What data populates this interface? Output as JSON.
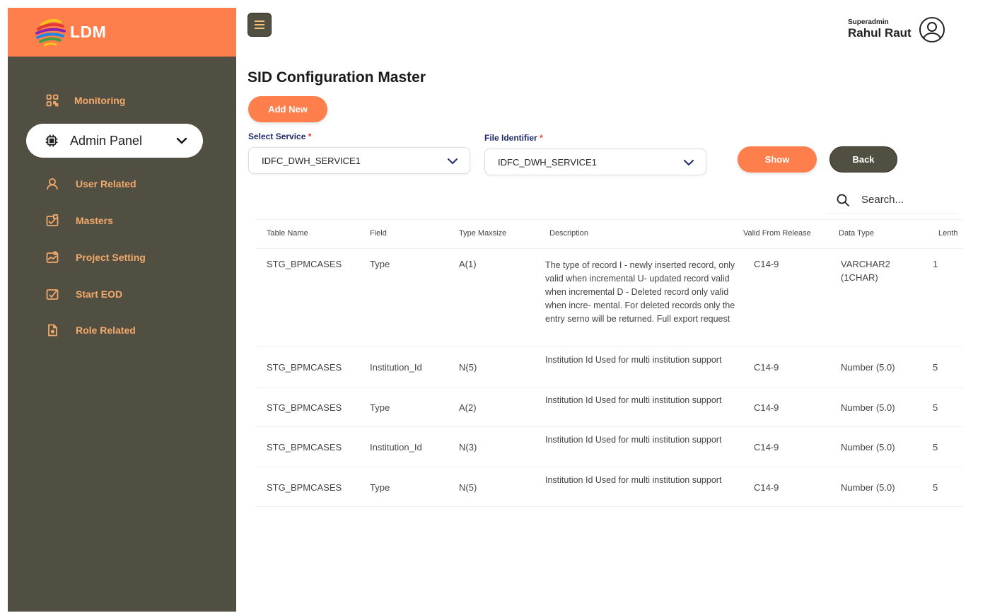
{
  "app": {
    "name": "LDM"
  },
  "sidebar": {
    "items": [
      {
        "label": "Monitoring",
        "icon": "grid-icon"
      },
      {
        "label": "Admin Panel",
        "icon": "chip-icon",
        "active": true
      },
      {
        "label": "User Related",
        "icon": "user-icon"
      },
      {
        "label": "Masters",
        "icon": "masters-icon"
      },
      {
        "label": "Project Setting",
        "icon": "project-setting-icon"
      },
      {
        "label": "Start EOD",
        "icon": "start-eod-icon"
      },
      {
        "label": "Role Related",
        "icon": "document-icon"
      }
    ]
  },
  "header": {
    "role": "Superadmin",
    "user_name": "Rahul Raut"
  },
  "page": {
    "title": "SID Configuration Master",
    "add_new_label": "Add New",
    "show_label": "Show",
    "back_label": "Back"
  },
  "filters": {
    "service_label": "Select Service",
    "service_value": "IDFC_DWH_SERVICE1",
    "file_label": "File Identifier",
    "file_value": "IDFC_DWH_SERVICE1",
    "required_mark": "*"
  },
  "search": {
    "placeholder": "Search..."
  },
  "table": {
    "headers": [
      "Table Name",
      "Field",
      "Type Maxsize",
      "Description",
      "Valid From Release",
      "Data Type",
      "Lenth"
    ],
    "rows": [
      {
        "table_name": "STG_BPMCASES",
        "field": "Type",
        "type_maxsize": "A(1)",
        "description": "The type of record I - newly inserted record, only valid when incremental U- updated record valid when incremental D - Deleted record only valid when incre- mental. For deleted records only the entry serno will be returned. Full export request",
        "valid_from": "C14-9",
        "data_type": "VARCHAR2 (1CHAR)",
        "length": "1"
      },
      {
        "table_name": "STG_BPMCASES",
        "field": "Institution_Id",
        "type_maxsize": "N(5)",
        "description": "Institution Id Used for multi institution support",
        "valid_from": "C14-9",
        "data_type": "Number (5.0)",
        "length": "5"
      },
      {
        "table_name": "STG_BPMCASES",
        "field": "Type",
        "type_maxsize": "A(2)",
        "description": "Institution Id Used for multi institution support",
        "valid_from": "C14-9",
        "data_type": "Number (5.0)",
        "length": "5"
      },
      {
        "table_name": "STG_BPMCASES",
        "field": "Institution_Id",
        "type_maxsize": "N(3)",
        "description": "Institution Id Used for multi institution support",
        "valid_from": "C14-9",
        "data_type": "Number (5.0)",
        "length": "5"
      },
      {
        "table_name": "STG_BPMCASES",
        "field": "Type",
        "type_maxsize": "N(5)",
        "description": "Institution Id Used for multi institution support",
        "valid_from": "C14-9",
        "data_type": "Number (5.0)",
        "length": "5"
      }
    ]
  },
  "colors": {
    "accent": "#fe7e4c",
    "sidebar_bg": "#514f41",
    "nav_text": "#f2a96c",
    "label_blue": "#1f2a6b"
  }
}
